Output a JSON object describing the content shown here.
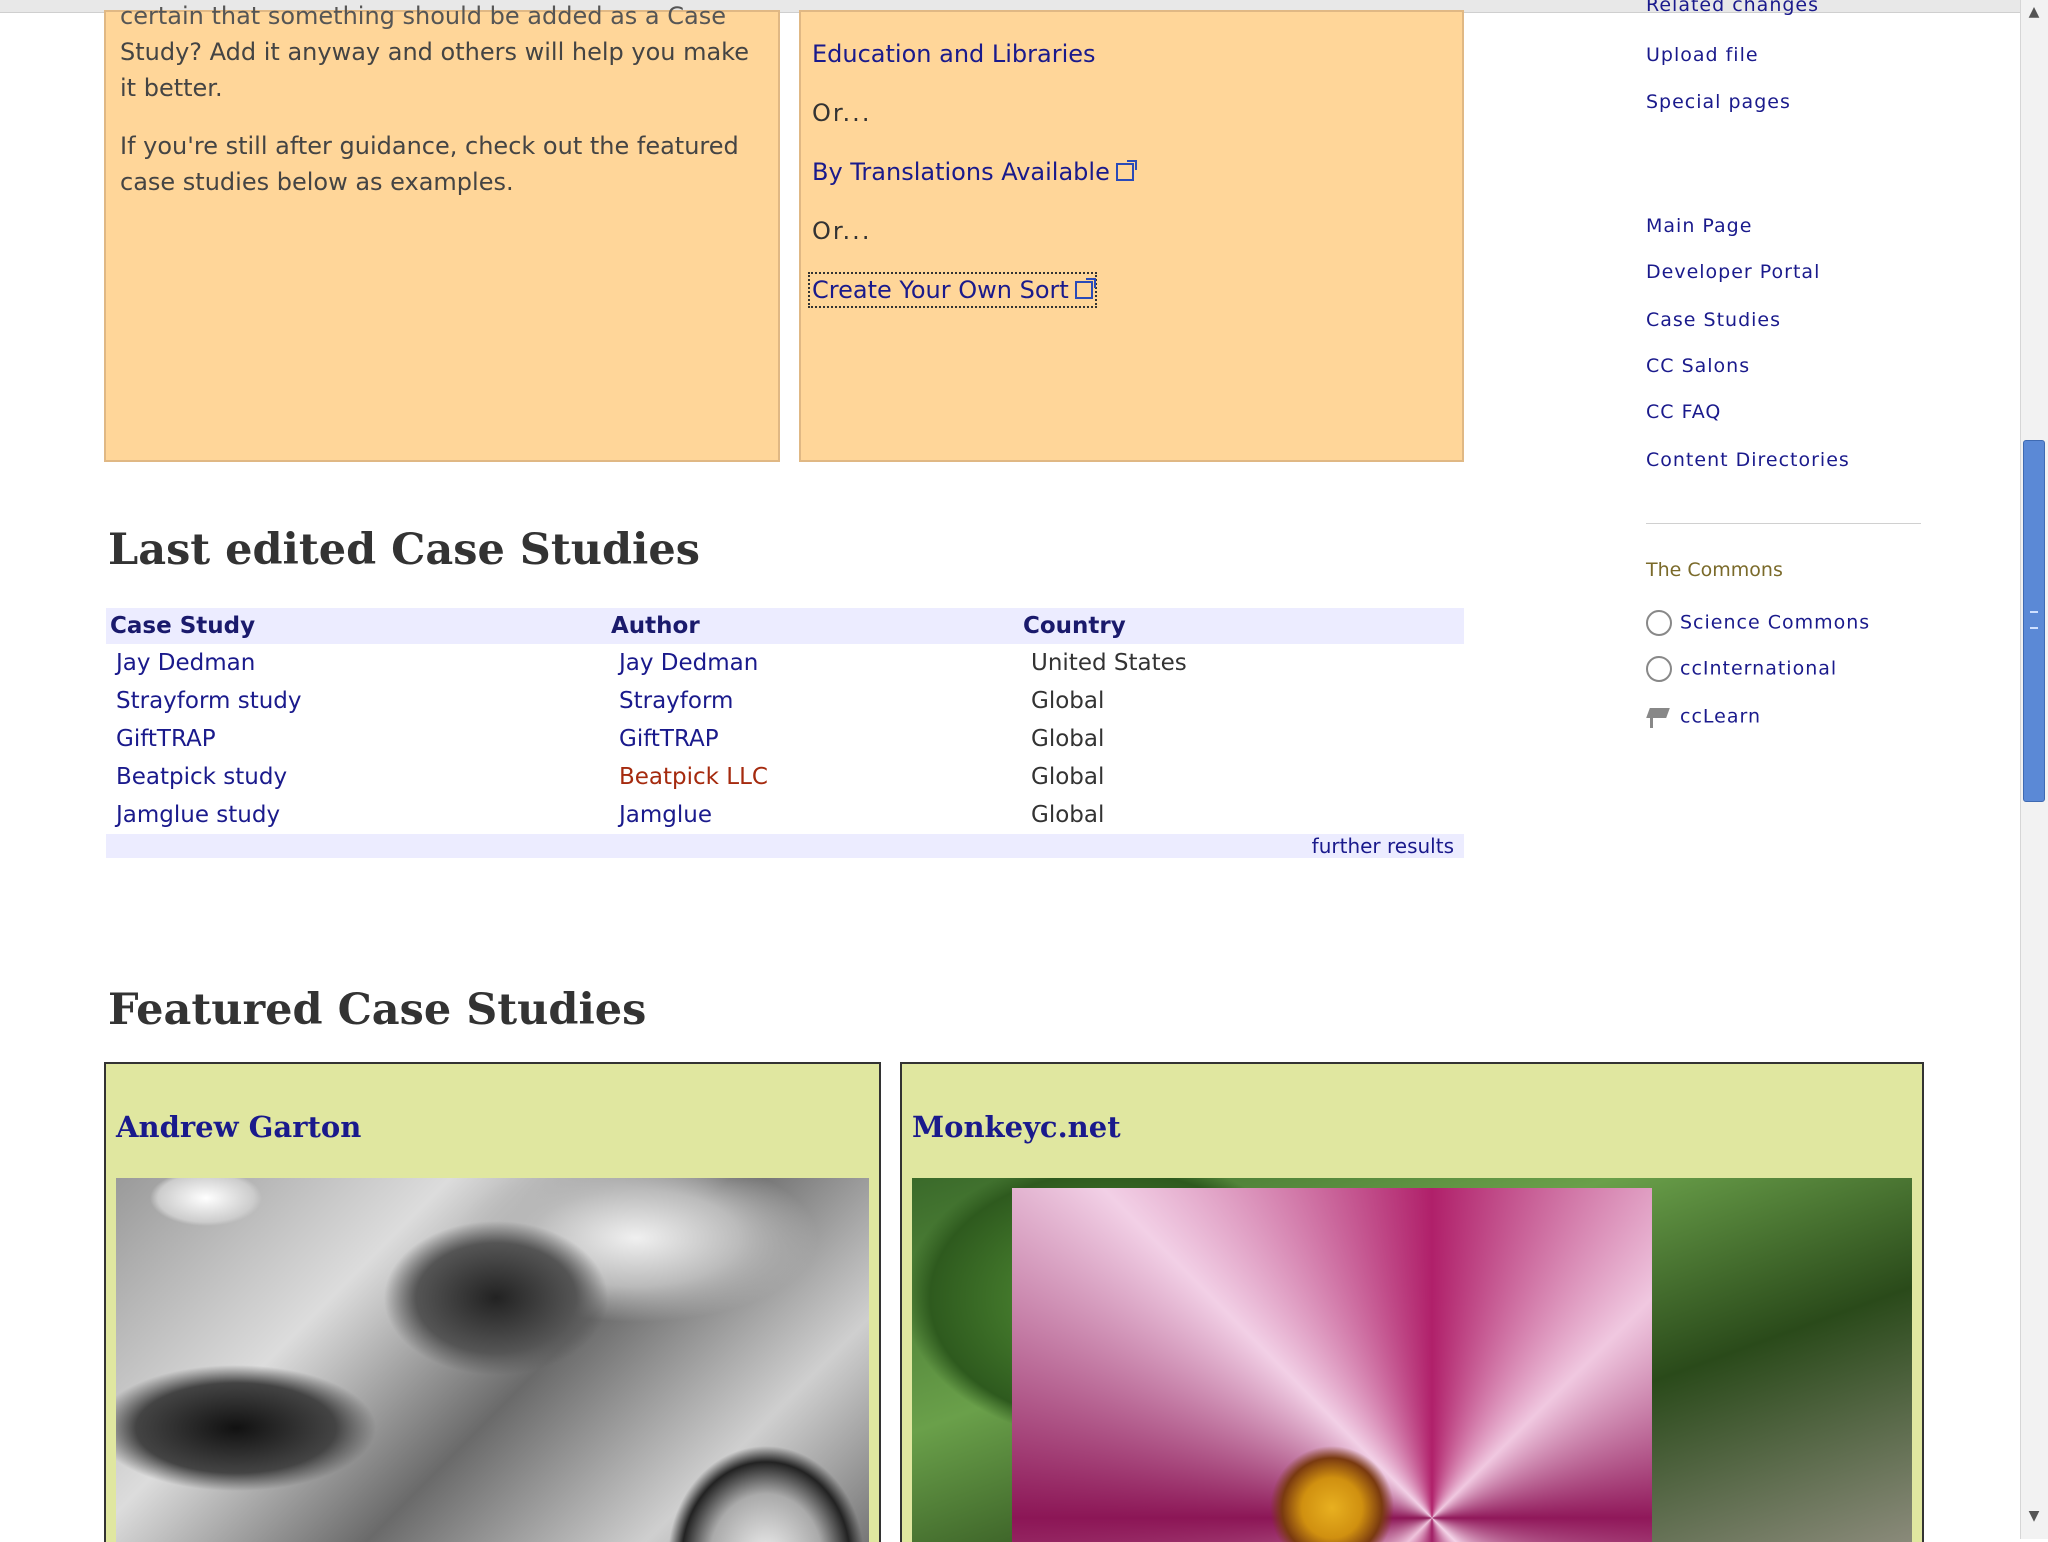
{
  "intro_left": {
    "line_cut": "certain that something should be added as a Case",
    "p1": "Study? Add it anyway and others will help you make it better.",
    "p2": "If you're still after guidance, check out the featured case studies below as examples."
  },
  "intro_right": {
    "link_education": "Education and Libraries",
    "or_1": "Or...",
    "link_translations": "By Translations Available",
    "or_2": "Or...",
    "link_create": "Create Your Own Sort"
  },
  "last_edited": {
    "heading": "Last edited Case Studies",
    "columns": [
      "Case Study",
      "Author",
      "Country"
    ],
    "rows": [
      {
        "case": "Jay Dedman",
        "author": "Jay Dedman",
        "country": "United States"
      },
      {
        "case": "Strayform study",
        "author": "Strayform",
        "country": "Global"
      },
      {
        "case": "GiftTRAP",
        "author": "GiftTRAP",
        "country": "Global"
      },
      {
        "case": "Beatpick study",
        "author": "Beatpick LLC",
        "country": "Global"
      },
      {
        "case": "Jamglue study",
        "author": "Jamglue",
        "country": "Global"
      }
    ],
    "further_results": "further results"
  },
  "featured": {
    "heading": "Featured Case Studies",
    "cards": [
      {
        "title": "Andrew Garton"
      },
      {
        "title": "Monkeyc.net"
      }
    ]
  },
  "sidebar": {
    "top_links": [
      "Related changes",
      "Upload file",
      "Special pages"
    ],
    "nav_links": [
      "Main Page",
      "Developer Portal",
      "Case Studies",
      "CC Salons",
      "CC FAQ",
      "Content Directories"
    ],
    "commons_title": "The Commons",
    "commons_links": [
      {
        "label": "Science Commons",
        "icon": "science-commons-icon"
      },
      {
        "label": "ccInternational",
        "icon": "globe-icon"
      },
      {
        "label": "ccLearn",
        "icon": "graduation-cap-icon"
      }
    ]
  },
  "colors": {
    "intro_box": "#ffd699",
    "card_bg": "#e0e7a0",
    "table_header": "#ececff",
    "link": "#1a1a8c",
    "scroll_thumb": "#5b89d6"
  }
}
